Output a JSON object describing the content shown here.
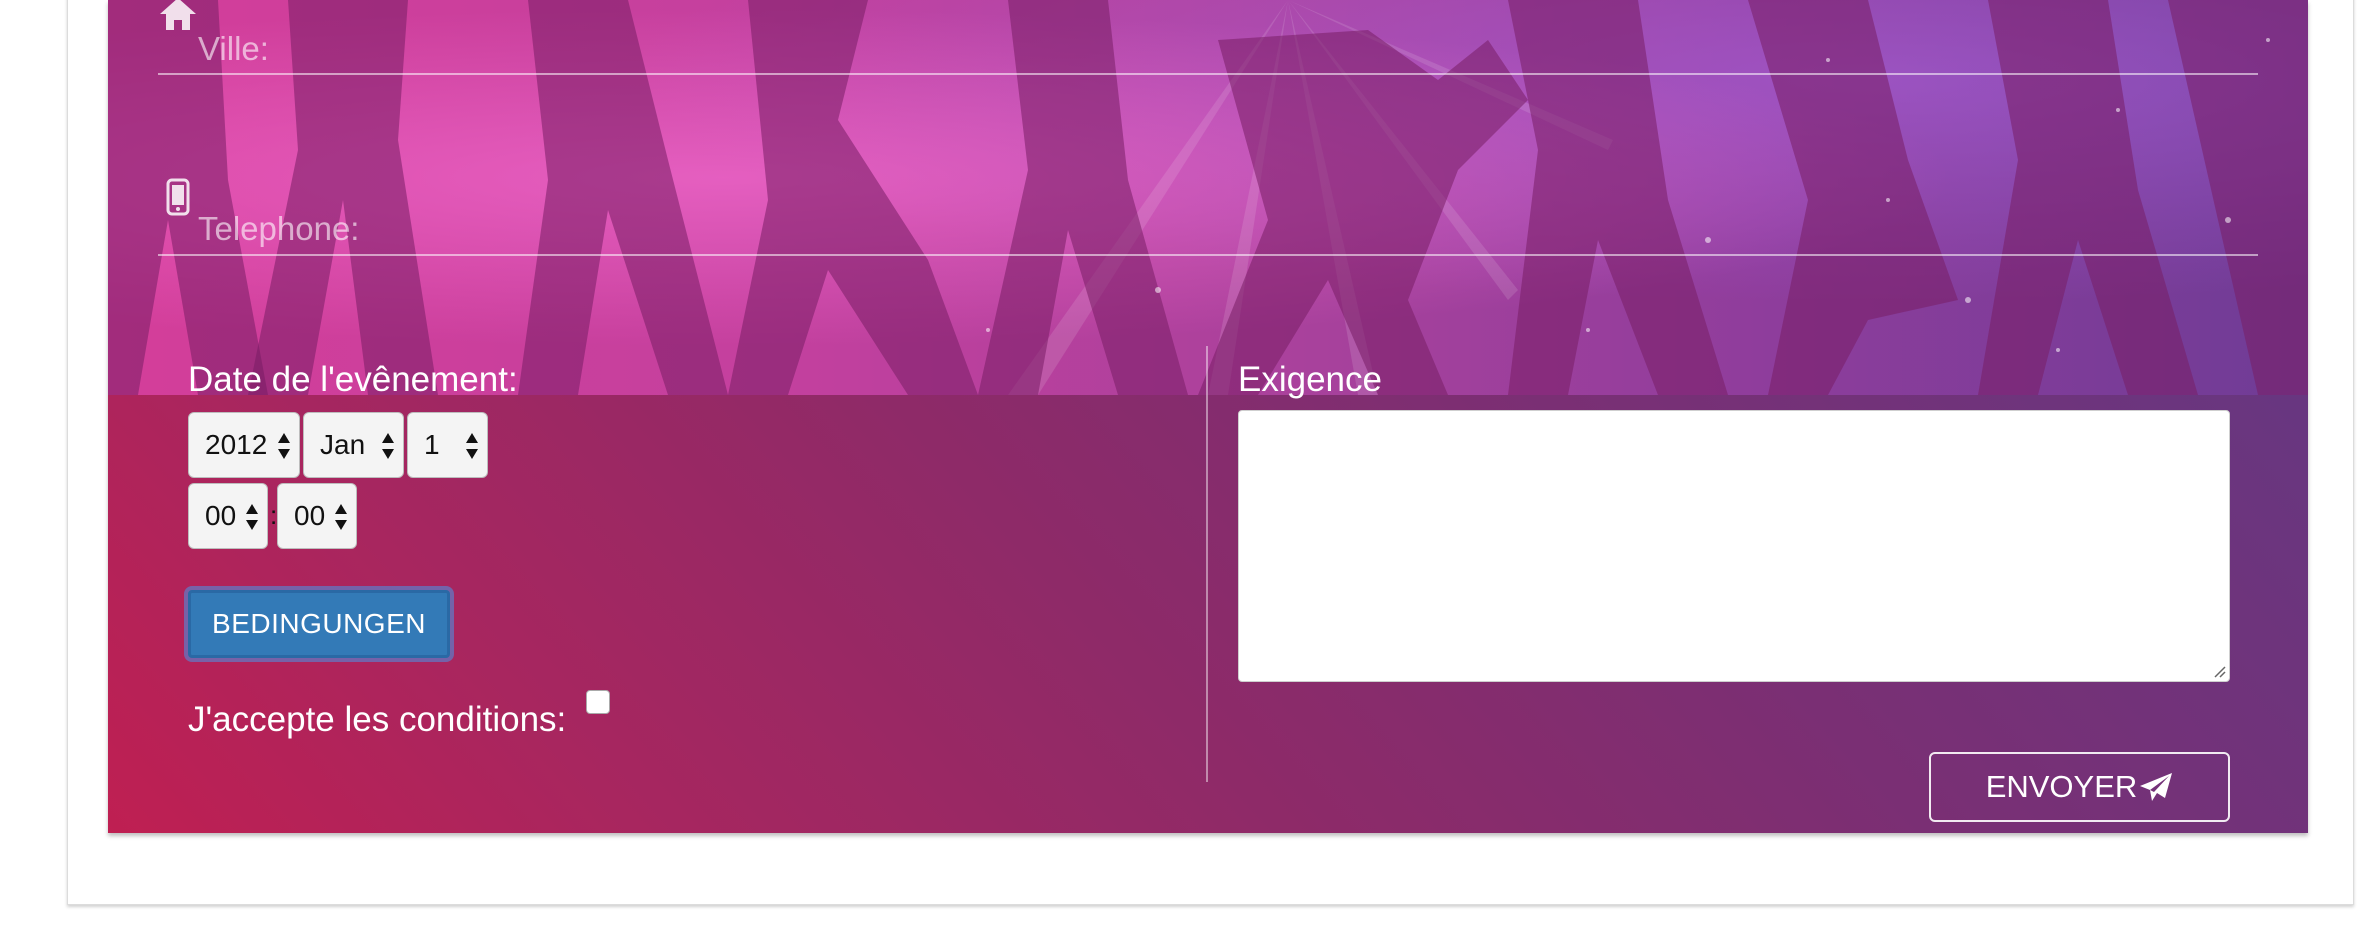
{
  "form": {
    "ville_label": "Ville:",
    "telephone_label": "Telephone:",
    "date_label": "Date de l'evênement:",
    "year_value": "2012",
    "month_value": "Jan",
    "day_value": "1",
    "hour_value": "00",
    "time_separator": ":",
    "minute_value": "00",
    "conditions_button_label": "BEDINGUNGEN",
    "accept_label": "J'accepte les conditions:",
    "exigence_label": "Exigence",
    "exigence_value": "",
    "submit_label": "ENVOYER"
  },
  "icons": {
    "ville": "home-icon",
    "telephone": "mobile-phone-icon",
    "submit": "paper-plane-icon"
  },
  "colors": {
    "gradient_start": "#bf1f52",
    "gradient_end": "#5f3a86",
    "conditions_button": "#337ab7"
  }
}
